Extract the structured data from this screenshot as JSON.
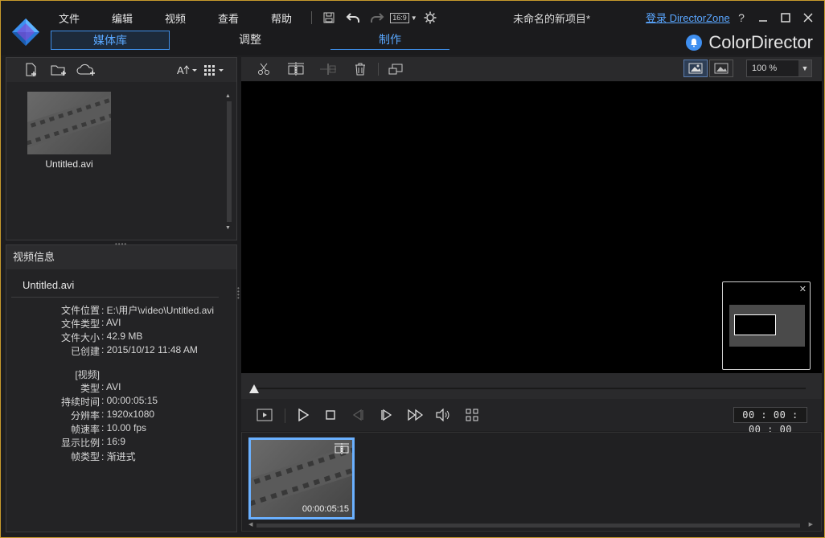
{
  "app": {
    "project_title": "未命名的新项目*",
    "login_link": "登录 DirectorZone",
    "brand_name": "ColorDirector",
    "help_glyph": "?"
  },
  "menu": {
    "items": [
      "文件",
      "编辑",
      "视频",
      "查看",
      "帮助"
    ],
    "aspect_ratio": "16:9"
  },
  "tabs": [
    {
      "label": "媒体库",
      "state": "selected"
    },
    {
      "label": "调整",
      "state": "normal"
    },
    {
      "label": "制作",
      "state": "current"
    }
  ],
  "library": {
    "items": [
      {
        "name": "Untitled.avi"
      }
    ]
  },
  "video_info": {
    "header": "视频信息",
    "file_name": "Untitled.avi",
    "general": [
      {
        "label": "文件位置",
        "value": "E:\\用户\\video\\Untitled.avi"
      },
      {
        "label": "文件类型",
        "value": "AVI"
      },
      {
        "label": "文件大小",
        "value": "42.9 MB"
      },
      {
        "label": "已创建",
        "value": "2015/10/12 11:48 AM"
      }
    ],
    "section_title": "[视频]",
    "video": [
      {
        "label": "类型",
        "value": "AVI"
      },
      {
        "label": "持续时间",
        "value": "00:00:05:15"
      },
      {
        "label": "分辨率",
        "value": "1920x1080"
      },
      {
        "label": "帧速率",
        "value": "10.00 fps"
      },
      {
        "label": "显示比例",
        "value": "16:9"
      },
      {
        "label": "帧类型",
        "value": "渐进式"
      }
    ]
  },
  "preview": {
    "zoom": "100 %",
    "timecode": "00 : 00 : 00 : 00",
    "seek_position": 0
  },
  "timeline": {
    "clips": [
      {
        "duration": "00:00:05:15",
        "selected": true
      }
    ]
  },
  "colors": {
    "accent": "#3e8ee8",
    "link": "#5aa6ff",
    "clip_border": "#6ab0ff",
    "window_border": "#c89a2c"
  }
}
